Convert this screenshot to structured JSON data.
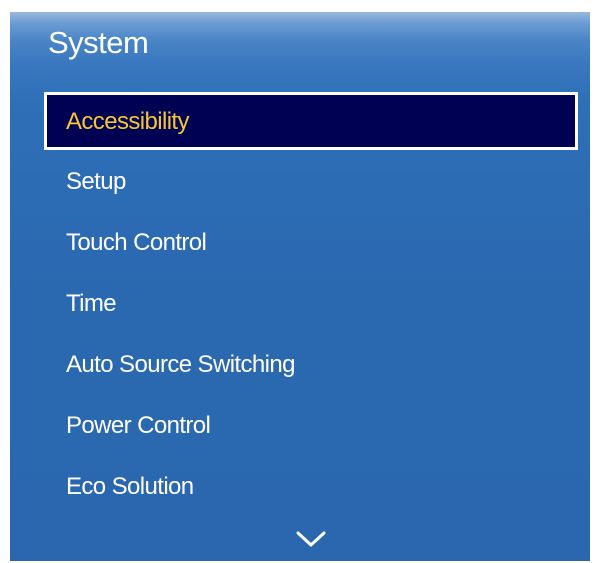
{
  "panel": {
    "title": "System"
  },
  "menu": {
    "items": [
      {
        "label": "Accessibility",
        "selected": true
      },
      {
        "label": "Setup",
        "selected": false
      },
      {
        "label": "Touch Control",
        "selected": false
      },
      {
        "label": "Time",
        "selected": false
      },
      {
        "label": "Auto Source Switching",
        "selected": false
      },
      {
        "label": "Power Control",
        "selected": false
      },
      {
        "label": "Eco Solution",
        "selected": false
      }
    ],
    "more_indicator_icon": "chevron-down-icon"
  },
  "colors": {
    "panel_blue": "#2a68b0",
    "selected_bg": "#010154",
    "selected_text": "#f5c535",
    "text": "#ffffff"
  }
}
